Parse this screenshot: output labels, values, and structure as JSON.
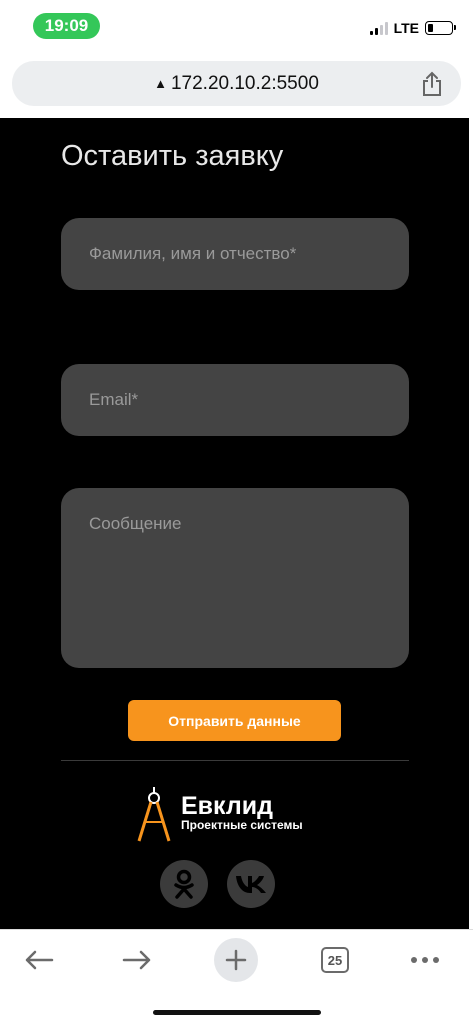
{
  "status": {
    "time": "19:09",
    "network": "LTE"
  },
  "browser": {
    "url": "172.20.10.2:5500",
    "tab_count": "25"
  },
  "form": {
    "title": "Оставить заявку",
    "name_placeholder": "Фамилия, имя и отчество*",
    "email_placeholder": "Email*",
    "message_placeholder": "Сообщение",
    "submit_label": "Отправить данные"
  },
  "footer": {
    "brand": "Евклид",
    "tagline": "Проектные системы",
    "social": [
      "odnoklassniki-icon",
      "vk-icon"
    ]
  },
  "colors": {
    "accent": "#f7941d",
    "field_bg": "#444444",
    "page_bg": "#000000",
    "time_pill": "#34c759"
  }
}
